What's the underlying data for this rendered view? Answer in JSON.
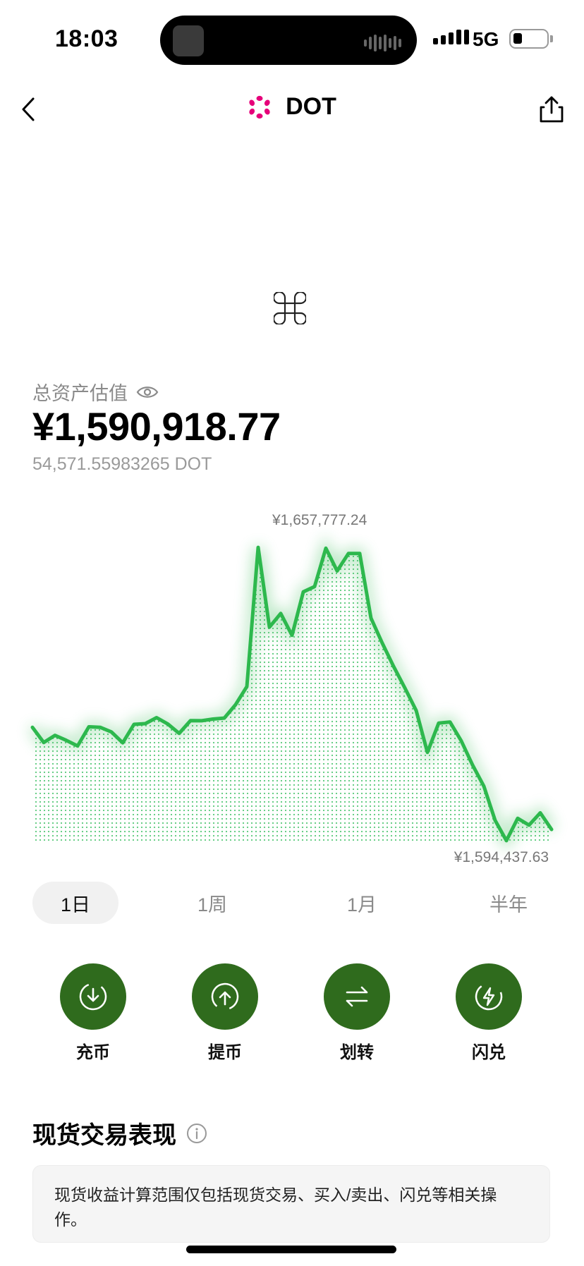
{
  "status_bar": {
    "time": "18:03",
    "network": "5G"
  },
  "nav": {
    "title": "DOT"
  },
  "asset": {
    "label": "总资产估值",
    "value": "¥1,590,918.77",
    "amount": "54,571.55983265 DOT"
  },
  "chart_data": {
    "type": "area",
    "max_label": "¥1,657,777.24",
    "min_label": "¥1,594,437.63",
    "y_range": [
      1594437.63,
      1657777.24
    ],
    "values": [
      1618920,
      1615640,
      1617180,
      1616100,
      1614900,
      1619020,
      1618920,
      1617910,
      1615570,
      1619560,
      1619710,
      1621000,
      1619620,
      1617610,
      1620350,
      1620330,
      1620700,
      1620910,
      1623810,
      1627720,
      1657760,
      1640540,
      1643490,
      1638770,
      1648150,
      1649300,
      1657580,
      1652680,
      1656440,
      1656440,
      1642490,
      1637090,
      1632070,
      1627410,
      1622570,
      1613520,
      1619840,
      1620060,
      1615980,
      1610770,
      1606210,
      1598820,
      1594450,
      1599270,
      1597810,
      1600450,
      1596880
    ],
    "color": "#2db84d"
  },
  "periods": [
    "1日",
    "1周",
    "1月",
    "半年"
  ],
  "active_period": "1日",
  "actions": [
    {
      "label": "充币",
      "icon": "deposit-icon"
    },
    {
      "label": "提币",
      "icon": "withdraw-icon"
    },
    {
      "label": "划转",
      "icon": "transfer-icon"
    },
    {
      "label": "闪兑",
      "icon": "flash-swap-icon"
    }
  ],
  "section": {
    "title": "现货交易表现",
    "note": "现货收益计算范围仅包括现货交易、买入/卖出、闪兑等相关操作。"
  },
  "colors": {
    "accent_green": "#2db84d",
    "action_bg": "#2f6b1d",
    "coin_logo": "#e6007a"
  }
}
